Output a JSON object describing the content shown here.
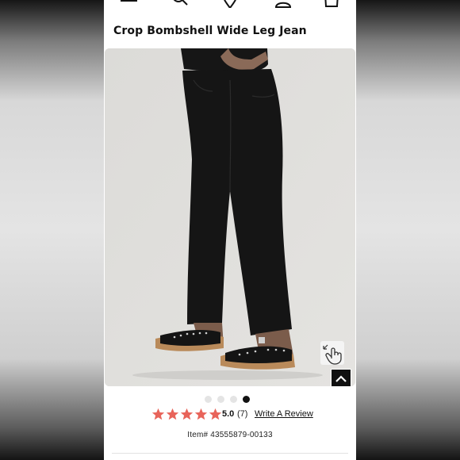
{
  "product": {
    "title": "Crop Bombshell Wide Leg Jean",
    "rating_value": "5.0",
    "rating_stars": 5,
    "review_count": "(7)",
    "write_review_label": "Write A Review",
    "item_number": "Item# 43555879-00133"
  },
  "gallery": {
    "image_count": 4,
    "active_index": 3
  },
  "header_icons": [
    "menu-icon",
    "search-icon",
    "location-pin-icon",
    "account-icon",
    "cart-icon"
  ],
  "colors": {
    "star": "#e8645a",
    "text": "#111111",
    "accent_dark": "#111111"
  }
}
